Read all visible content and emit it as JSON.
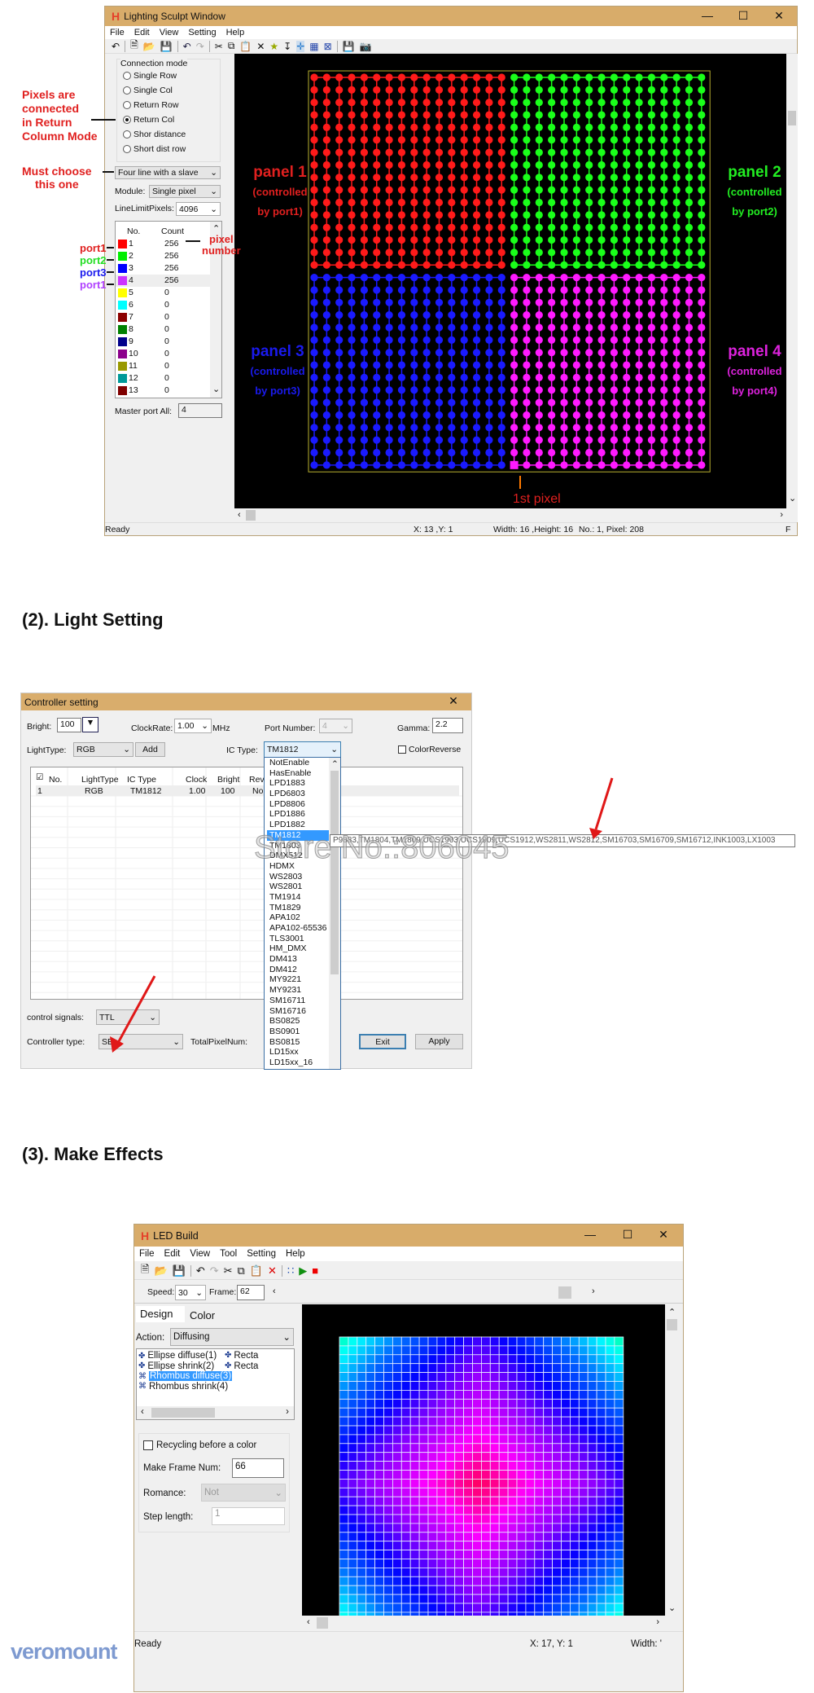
{
  "sculpt": {
    "title": "Lighting Sculpt Window",
    "menu": [
      "File",
      "Edit",
      "View",
      "Setting",
      "Help"
    ],
    "connection_mode_label": "Connection mode",
    "modes": [
      {
        "label": "Single Row",
        "checked": false
      },
      {
        "label": "Single Col",
        "checked": false
      },
      {
        "label": "Return Row",
        "checked": false
      },
      {
        "label": "Return Col",
        "checked": true
      },
      {
        "label": "Shor distance",
        "checked": false
      },
      {
        "label": "Short dist row",
        "checked": false
      }
    ],
    "line_mode": "Four line with a slave",
    "module_label": "Module:",
    "module_value": "Single pixel",
    "line_limit_label": "LineLimitPixels:",
    "line_limit_value": "4096",
    "list_headers": [
      "No.",
      "Count"
    ],
    "ports": [
      {
        "no": "1",
        "count": "256",
        "color": "#ff0000"
      },
      {
        "no": "2",
        "count": "256",
        "color": "#00ee00"
      },
      {
        "no": "3",
        "count": "256",
        "color": "#0000ff"
      },
      {
        "no": "4",
        "count": "256",
        "color": "#cc33ff"
      },
      {
        "no": "5",
        "count": "0",
        "color": "#ffff00"
      },
      {
        "no": "6",
        "count": "0",
        "color": "#00ffff"
      },
      {
        "no": "7",
        "count": "0",
        "color": "#8b0000"
      },
      {
        "no": "8",
        "count": "0",
        "color": "#008000"
      },
      {
        "no": "9",
        "count": "0",
        "color": "#00008b"
      },
      {
        "no": "10",
        "count": "0",
        "color": "#8b008b"
      },
      {
        "no": "11",
        "count": "0",
        "color": "#999900"
      },
      {
        "no": "12",
        "count": "0",
        "color": "#009999"
      },
      {
        "no": "13",
        "count": "0",
        "color": "#800000"
      }
    ],
    "master_port_label": "Master port All:",
    "master_port_value": "4",
    "status": {
      "ready": "Ready",
      "xy": "X: 13 ,Y: 1",
      "size": "Width: 16 ,Height: 16",
      "pixel": "No.: 1, Pixel: 208",
      "extra": "F"
    },
    "grid": {
      "cols": 32,
      "rows": 32,
      "quadrant_colors": [
        "#ff1a1a",
        "#1aff1a",
        "#1a1aff",
        "#ff1aff"
      ]
    },
    "annotations": {
      "return_mode": [
        "Pixels are",
        "connected",
        "in Return",
        "Column Mode"
      ],
      "must_choose": [
        "Must choose",
        "this one"
      ],
      "port_labels": [
        {
          "text": "port1",
          "color": "#e0201f"
        },
        {
          "text": "port2",
          "color": "#22dd22"
        },
        {
          "text": "port3",
          "color": "#1a1aee"
        },
        {
          "text": "port1",
          "color": "#b040ff"
        }
      ],
      "pixel_number": [
        "pixel",
        "number"
      ],
      "panels": [
        {
          "lines": [
            "panel 1",
            "(controlled",
            "by port1)"
          ],
          "color": "#e0201f"
        },
        {
          "lines": [
            "panel 2",
            "(controlled",
            "by port2)"
          ],
          "color": "#22ee22"
        },
        {
          "lines": [
            "panel 3",
            "(controlled",
            "by port3)"
          ],
          "color": "#1a1aee"
        },
        {
          "lines": [
            "panel 4",
            "(controlled",
            "by port4)"
          ],
          "color": "#dd22dd"
        }
      ],
      "first_pixel": "1st pixel"
    }
  },
  "heading2": "(2). Light Setting",
  "controller": {
    "title": "Controller setting",
    "bright_label": "Bright:",
    "bright_value": "100",
    "clock_label": "ClockRate:",
    "clock_value": "1.00",
    "clock_unit": "MHz",
    "port_label": "Port Number:",
    "port_value": "4",
    "gamma_label": "Gamma:",
    "gamma_value": "2.2",
    "lighttype_label": "LightType:",
    "lighttype_value": "RGB",
    "add_label": "Add",
    "ictype_label": "IC Type:",
    "ictype_value": "TM1812",
    "colorreverse_label": "ColorReverse",
    "table_headers": [
      "No.",
      "LightType",
      "IC Type",
      "Clock",
      "Bright",
      "Rever"
    ],
    "table_rows": [
      [
        "1",
        "RGB",
        "TM1812",
        "1.00",
        "100",
        "No"
      ]
    ],
    "ic_options": [
      "NotEnable",
      "HasEnable",
      "LPD1883",
      "LPD6803",
      "LPD8806",
      "LPD1886",
      "LPD1882",
      "TM1812",
      "TM1803",
      "DMX512",
      "HDMX",
      "WS2803",
      "WS2801",
      "TM1914",
      "TM1829",
      "APA102",
      "APA102-65536",
      "TLS3001",
      "HM_DMX",
      "DM413",
      "DM412",
      "MY9221",
      "MY9231",
      "SM16711",
      "SM16716",
      "BS0825",
      "BS0901",
      "BS0815",
      "LD15xx",
      "LD15xx_16"
    ],
    "selected_ic": "TM1812",
    "tooltip": "P9883,TM1804,TM1809,UCS1903,UCS1909,UCS1912,WS2811,WS2812,SM16703,SM16709,SM16712,INK1003,LX1003",
    "watermark": "Store No.:806045",
    "control_signals_label": "control signals:",
    "control_signals_value": "TTL",
    "controller_type_label": "Controller type:",
    "controller_type_value": "SE",
    "total_pixel_label": "TotalPixelNum:",
    "exit_label": "Exit",
    "apply_label": "Apply"
  },
  "heading3": "(3). Make Effects",
  "ledbuild": {
    "title": "LED Build",
    "menu": [
      "File",
      "Edit",
      "View",
      "Tool",
      "Setting",
      "Help"
    ],
    "speed_label": "Speed:",
    "speed_value": "30",
    "frame_label": "Frame:",
    "frame_value": "62",
    "tabs": [
      "Design",
      "Color"
    ],
    "action_label": "Action:",
    "action_value": "Diffusing",
    "effects": [
      "Ellipse diffuse(1)",
      "Ellipse shrink(2)",
      "Rhombus diffuse(3)",
      "Rhombus shrink(4)"
    ],
    "effects_col2": [
      "Recta",
      "Recta"
    ],
    "selected_effect": "Rhombus diffuse(3)",
    "recycling_label": "Recycling before a color",
    "frame_num_label": "Make Frame Num:",
    "frame_num_value": "66",
    "romance_label": "Romance:",
    "romance_value": "Not",
    "step_label": "Step length:",
    "step_value": "1",
    "status": {
      "ready": "Ready",
      "xy": "X: 17, Y: 1",
      "width": "Width: '"
    },
    "grid": {
      "cols": 32,
      "rows": 32,
      "effect": "rhombus diffuse",
      "center_color": "#ff0066",
      "edge_color": "#00ffcc"
    }
  },
  "watermark_logo": "veromount"
}
